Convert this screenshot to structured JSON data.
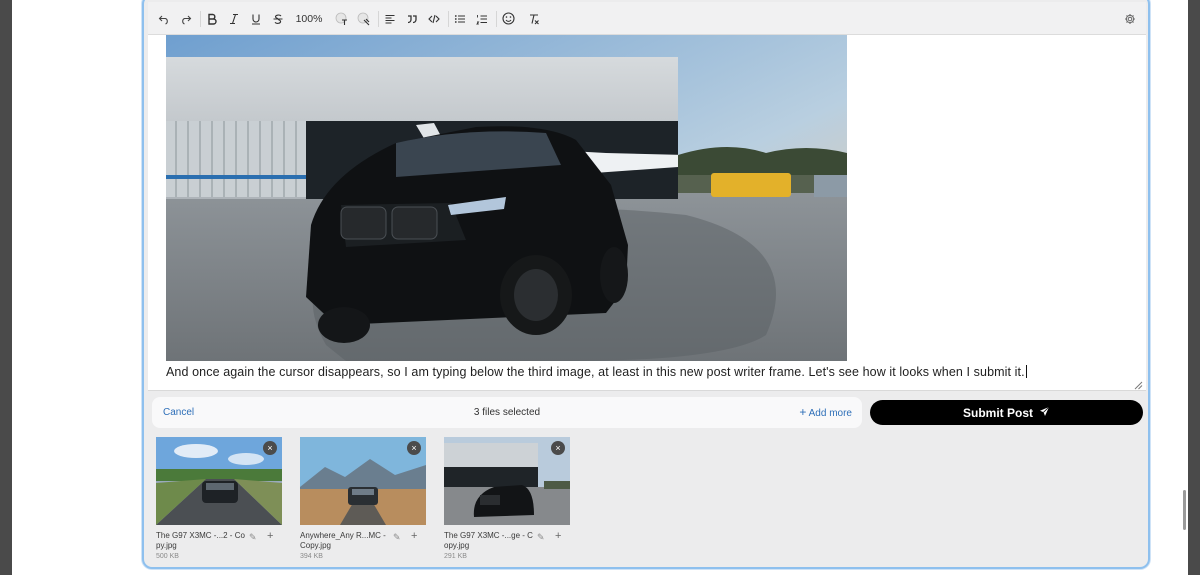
{
  "toolbar": {
    "zoom": "100%"
  },
  "editor": {
    "text": "And once again the cursor disappears, so I am typing below the third image, at least in this new post writer frame. Let's see how it looks when I submit it."
  },
  "files_bar": {
    "cancel_label": "Cancel",
    "count_label": "3 files selected",
    "add_more_label": "Add more"
  },
  "submit": {
    "label": "Submit Post"
  },
  "files": [
    {
      "name": "The G97 X3MC -...2 - Copy.jpg",
      "size": "500 KB",
      "remove_label": "×"
    },
    {
      "name": "Anywhere_Any R...MC - Copy.jpg",
      "size": "394 KB",
      "remove_label": "×"
    },
    {
      "name": "The G97 X3MC -...ge - Copy.jpg",
      "size": "291 KB",
      "remove_label": "×"
    }
  ],
  "colors": {
    "accent_link": "#2e6fb8",
    "frame_border": "#8ec0ee",
    "submit_bg": "#000000"
  }
}
